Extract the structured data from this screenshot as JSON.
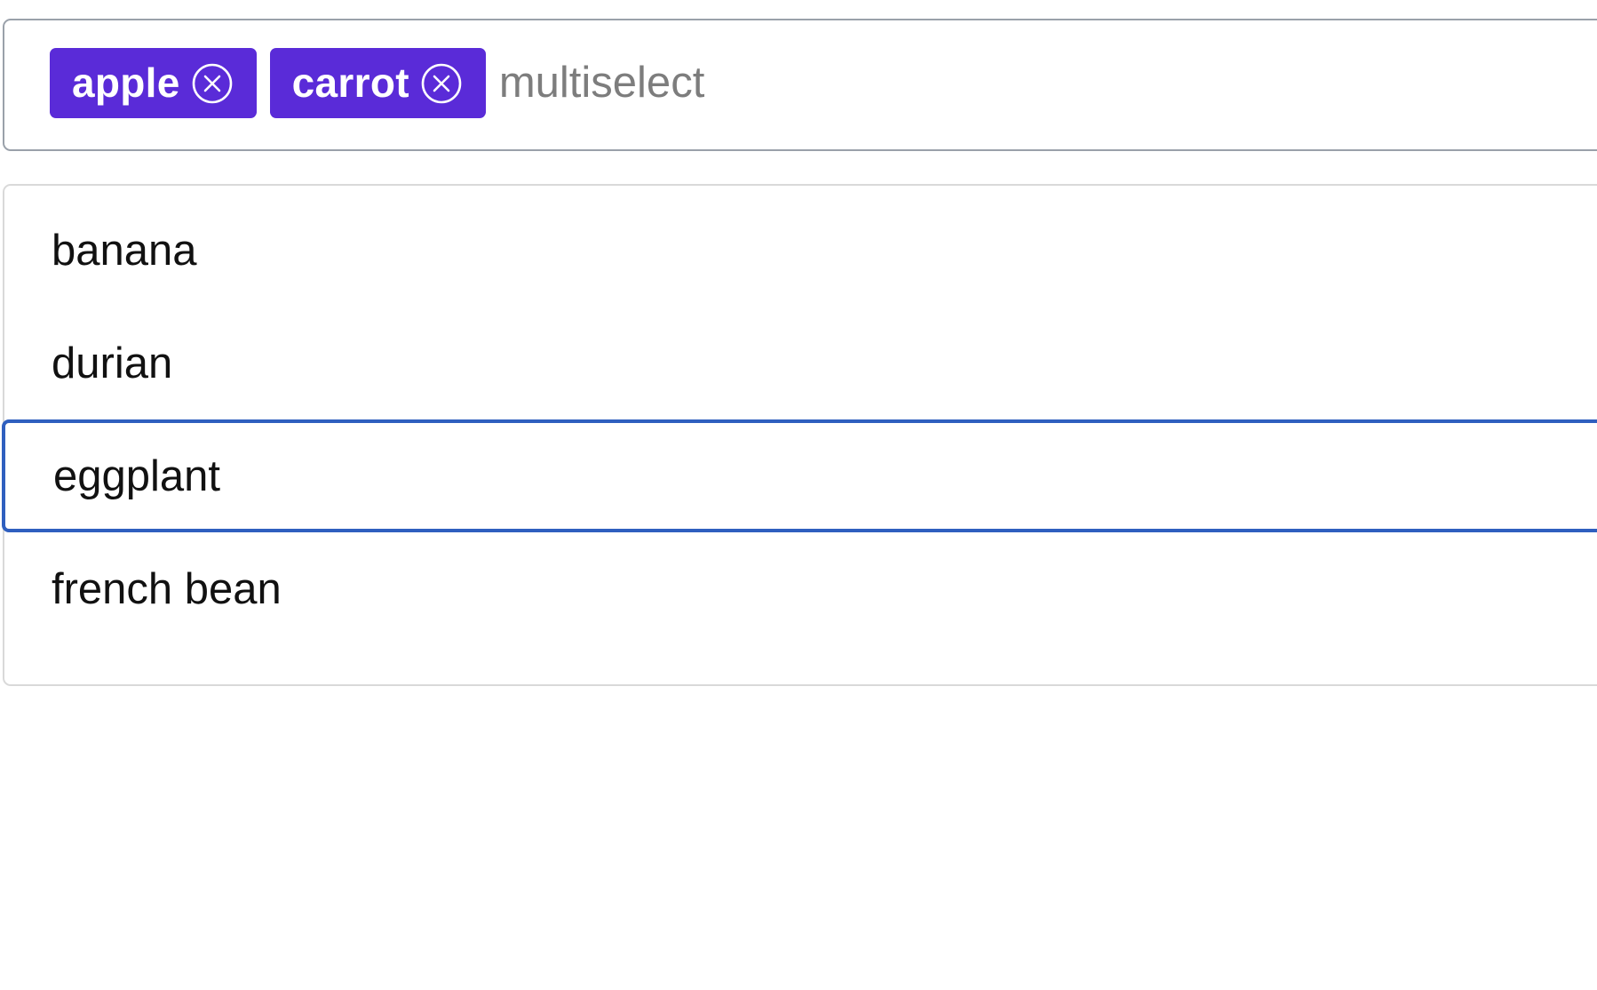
{
  "multiselect": {
    "selected": [
      {
        "label": "apple",
        "remove_icon": "circle-x-icon"
      },
      {
        "label": "carrot",
        "remove_icon": "circle-x-icon"
      }
    ],
    "input": {
      "placeholder": "multiselect",
      "value": ""
    },
    "tag_color": "#5a2bd8"
  },
  "dropdown": {
    "options": [
      {
        "label": "banana",
        "active": false
      },
      {
        "label": "durian",
        "active": false
      },
      {
        "label": "eggplant",
        "active": true
      },
      {
        "label": "french bean",
        "active": false
      }
    ],
    "active_border_color": "#2f5fbf"
  }
}
